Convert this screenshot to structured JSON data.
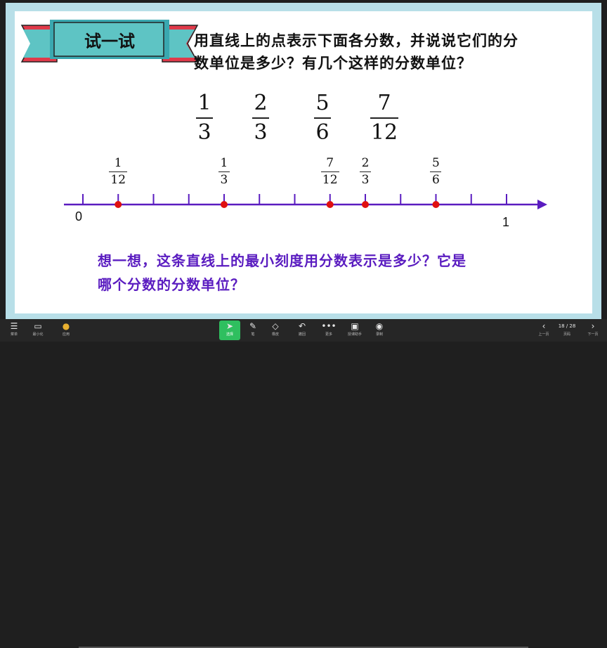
{
  "slide": {
    "banner": {
      "label": "试一试"
    },
    "question": {
      "line1": "用直线上的点表示下面各分数，并说说它们的分",
      "line2": "数单位是多少？有几个这样的分数单位？"
    },
    "fractions": [
      {
        "num": "1",
        "den": "3"
      },
      {
        "num": "2",
        "den": "3"
      },
      {
        "num": "5",
        "den": "6"
      },
      {
        "num": "7",
        "den": "12"
      }
    ],
    "number_line": {
      "start_label": "0",
      "end_label": "1",
      "tick_count": 12,
      "point_color": "#e01010",
      "line_color": "#5a1cc0",
      "points": [
        {
          "num": "1",
          "den": "12",
          "value": 0.0833
        },
        {
          "num": "1",
          "den": "3",
          "value": 0.3333
        },
        {
          "num": "7",
          "den": "12",
          "value": 0.5833
        },
        {
          "num": "2",
          "den": "3",
          "value": 0.6667
        },
        {
          "num": "5",
          "den": "6",
          "value": 0.8333
        }
      ]
    },
    "think": {
      "line1": "想一想，这条直线上的最小刻度用分数表示是多少？它是",
      "line2": "哪个分数的分数单位？"
    }
  },
  "toolbar": {
    "items": [
      {
        "icon": "menu-icon",
        "label": "菜单"
      },
      {
        "icon": "minimize-icon",
        "label": "最小化"
      },
      {
        "icon": "app-icon",
        "label": "应用"
      },
      {
        "icon": "cursor-icon",
        "label": "选择"
      },
      {
        "icon": "pen-icon",
        "label": "笔"
      },
      {
        "icon": "eraser-icon",
        "label": "橡皮"
      },
      {
        "icon": "undo-icon",
        "label": "撤回"
      },
      {
        "icon": "more-icon",
        "label": "更多"
      },
      {
        "icon": "tools-icon",
        "label": "授课助手"
      },
      {
        "icon": "record-icon",
        "label": "录制"
      }
    ],
    "prev_label": "上一页",
    "page_indicator": "18 / 28",
    "page_label": "页码",
    "next_label": "下一页"
  },
  "colors": {
    "slide_border": "#b8dfe8",
    "banner_teal": "#5ec4c4",
    "banner_ribbon": "#e03a4a",
    "think_text": "#5a1cc0",
    "accent_green": "#2fbf5f"
  }
}
